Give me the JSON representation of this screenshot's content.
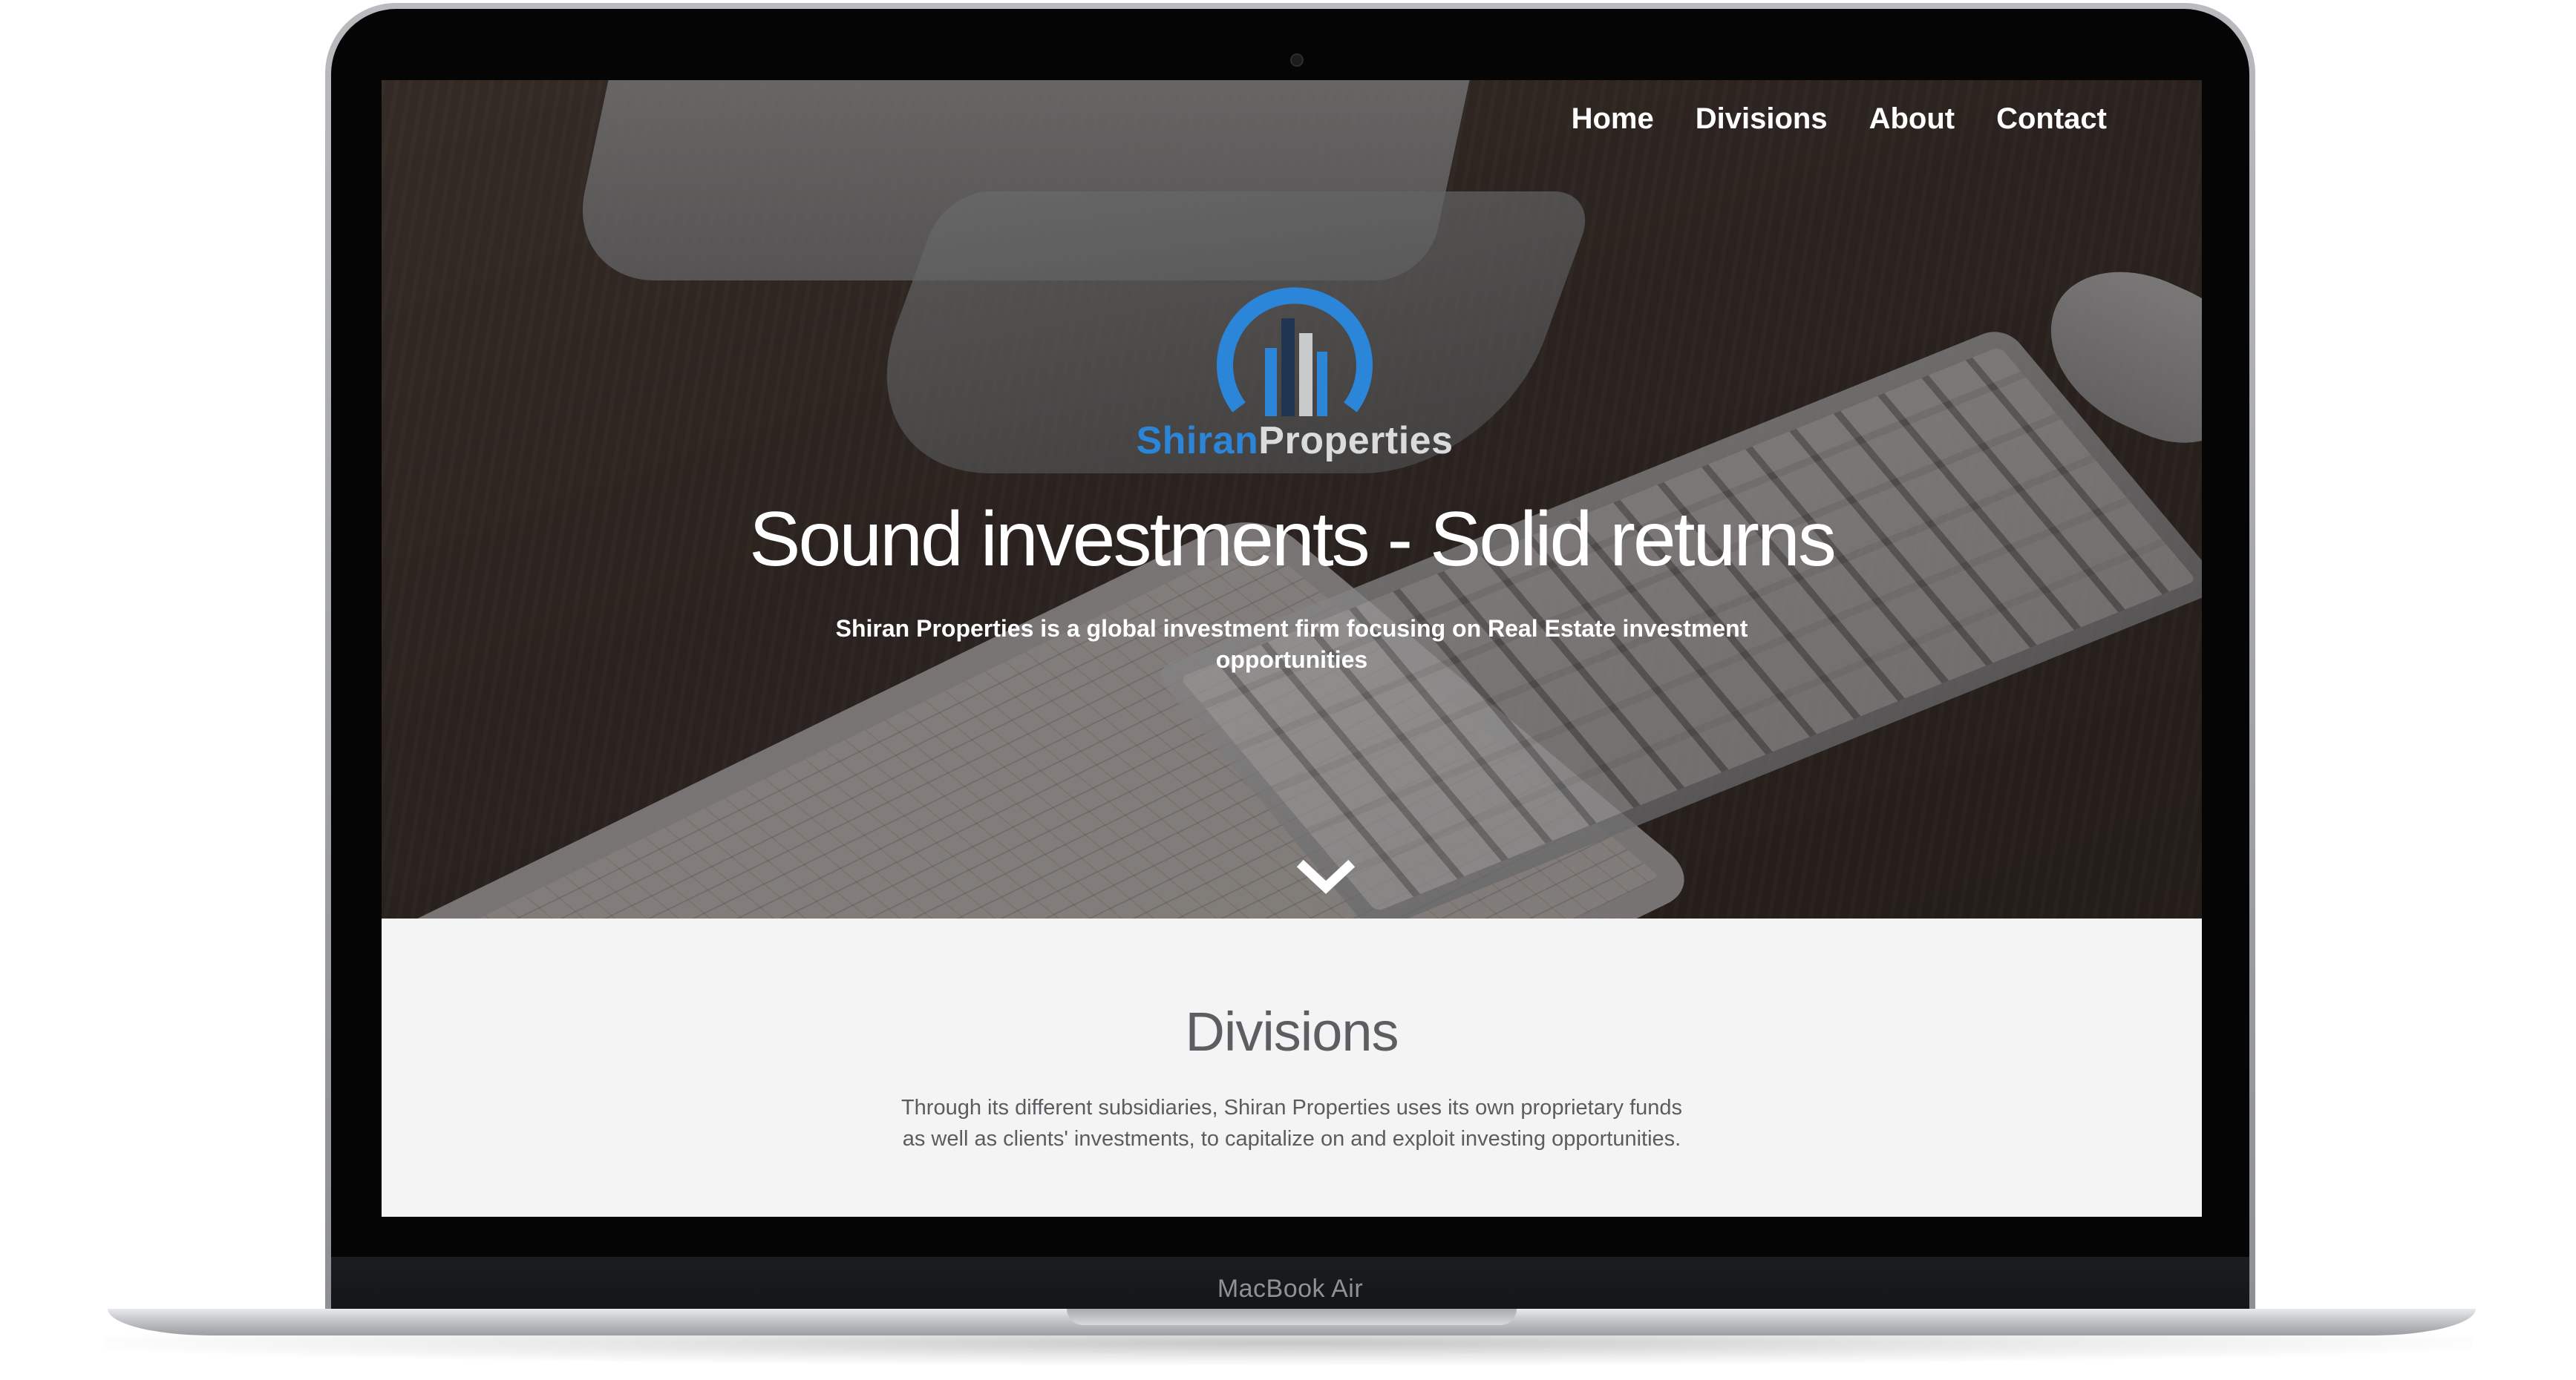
{
  "device": {
    "label": "MacBook Air"
  },
  "nav": {
    "items": [
      {
        "label": "Home"
      },
      {
        "label": "Divisions"
      },
      {
        "label": "About"
      },
      {
        "label": "Contact"
      }
    ]
  },
  "logo": {
    "word1": "Shiran",
    "word2": "Properties",
    "colors": {
      "primary": "#2b86d9",
      "secondary": "#d9dbdd"
    }
  },
  "hero": {
    "title": "Sound investments - Solid returns",
    "subtitle": "Shiran Properties is a global investment firm focusing on Real Estate investment opportunities",
    "scroll_icon": "chevron-down-icon"
  },
  "divisions": {
    "title": "Divisions",
    "text_line1": "Through its different subsidiaries, Shiran Properties uses its own proprietary funds",
    "text_line2": "as well as clients' investments, to capitalize on and exploit investing opportunities."
  }
}
